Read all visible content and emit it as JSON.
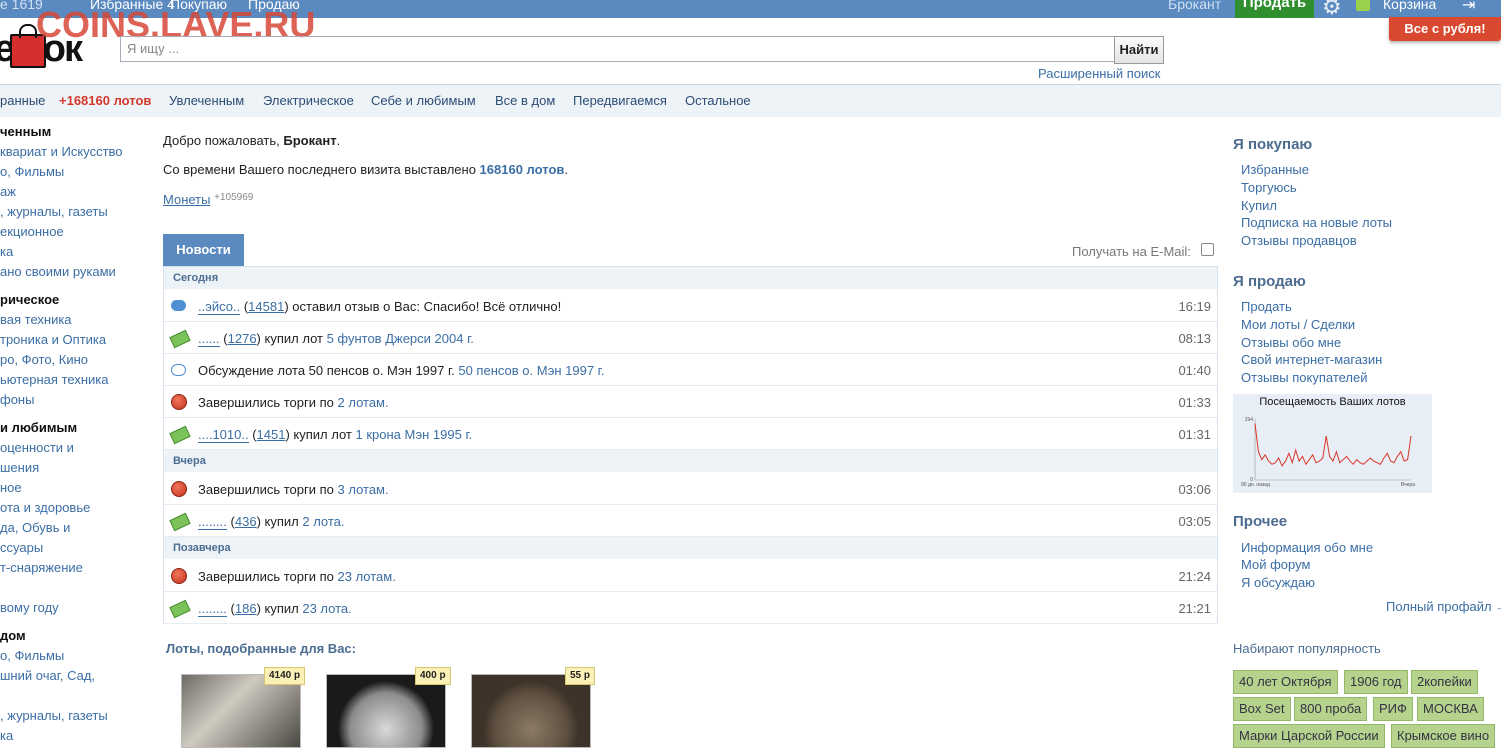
{
  "watermark": "COINS.LAVE.RU",
  "topbar": {
    "item1": "е 1619",
    "favorites": "Избранные 4",
    "buying": "Покупаю",
    "selling": "Продаю",
    "username": "Брокант",
    "sell_button": "Продать",
    "cart": "Корзина"
  },
  "logo": {
    "text": "ешок"
  },
  "search": {
    "placeholder": "Я ищу ...",
    "button": "Найти",
    "advanced": "Расширенный поиск"
  },
  "promo": "Все с рубля!",
  "nav": [
    "ранные",
    "+168160 лотов",
    "Увлеченным",
    "Электрическое",
    "Себе и любимым",
    "Все в дом",
    "Передвигаемся",
    "Остальное"
  ],
  "sidebar": [
    {
      "t": "ченным",
      "h": true
    },
    {
      "t": "квариат и Искусство"
    },
    {
      "t": "о, Фильмы"
    },
    {
      "t": "аж"
    },
    {
      "t": ", журналы, газеты"
    },
    {
      "t": "екционное"
    },
    {
      "t": "ка"
    },
    {
      "t": "ано своими руками"
    },
    {
      "t": "рическое",
      "h": true
    },
    {
      "t": "вая техника"
    },
    {
      "t": "троника и Оптика"
    },
    {
      "t": "ро, Фото, Кино"
    },
    {
      "t": "ьютерная техника"
    },
    {
      "t": "фоны"
    },
    {
      "t": "и любимым",
      "h": true
    },
    {
      "t": "оценности и"
    },
    {
      "t": "шения"
    },
    {
      "t": "ное"
    },
    {
      "t": "ота и здоровье"
    },
    {
      "t": "да, Обувь и"
    },
    {
      "t": "ссуары"
    },
    {
      "t": "т-снаряжение"
    },
    {
      "t": "вому году"
    },
    {
      "t": "дом",
      "h": true
    },
    {
      "t": "о, Фильмы"
    },
    {
      "t": "шний очаг, Сад,"
    },
    {
      "t": ", журналы, газеты"
    },
    {
      "t": "ка"
    }
  ],
  "welcome": {
    "prefix": "Добро пожаловать, ",
    "name": "Брокант",
    "suffix": "."
  },
  "since": {
    "prefix": "Со времени Вашего последнего визита выставлено ",
    "count": "168160 лотов",
    "suffix": "."
  },
  "coins": {
    "label": "Монеты",
    "count": "+105969"
  },
  "news": {
    "tab": "Новости",
    "email_label": "Получать на E-Mail:"
  },
  "feed": {
    "days": [
      "Сегодня",
      "Вчера",
      "Позавчера"
    ],
    "rows": [
      {
        "user": "..эйсо..",
        "num": "14581",
        "text": " оставил отзыв о Вас: Спасибо! Всё отлично!",
        "link": "",
        "time": "16:19"
      },
      {
        "user": "......",
        "num": "1276",
        "text": " купил лот ",
        "link": "5 фунтов Джерси 2004 г.",
        "time": "08:13"
      },
      {
        "user": "",
        "num": "",
        "text": "Обсуждение лота 50 пенсов о. Мэн 1997 г. ",
        "link": "50 пенсов о. Мэн 1997 г.",
        "time": "01:40"
      },
      {
        "user": "",
        "num": "",
        "text": "Завершились торги по ",
        "link": "2 лотам.",
        "time": "01:33"
      },
      {
        "user": "....1010..",
        "num": "1451",
        "text": " купил лот ",
        "link": "1 крона Мэн 1995 г.",
        "time": "01:31"
      },
      {
        "user": "",
        "num": "",
        "text": "Завершились торги по ",
        "link": "3 лотам.",
        "time": "03:06"
      },
      {
        "user": "........",
        "num": "436",
        "text": " купил ",
        "link": "2 лота.",
        "time": "03:05"
      },
      {
        "user": "",
        "num": "",
        "text": "Завершились торги по ",
        "link": "23 лотам.",
        "time": "21:24"
      },
      {
        "user": "........",
        "num": "186",
        "text": " купил ",
        "link": "23 лота.",
        "time": "21:21"
      }
    ]
  },
  "picked_title": "Лоты, подобранные для Вас:",
  "lots": [
    {
      "price": "4140 р"
    },
    {
      "price": "400 р"
    },
    {
      "price": "55 р"
    }
  ],
  "right": {
    "buy_h": "Я покупаю",
    "buy": [
      "Избранные",
      "Торгуюсь",
      "Купил",
      "Подписка на новые лоты",
      "Отзывы продавцов"
    ],
    "sell_h": "Я продаю",
    "sell": [
      "Продать",
      "Мои лоты / Сделки",
      "Отзывы обо мне",
      "Свой интернет-магазин",
      "Отзывы покупателей"
    ],
    "other_h": "Прочее",
    "other": [
      "Информация обо мне",
      "Мой форум",
      "Я обсуждаю"
    ],
    "full_profile": "Полный профайл →",
    "popular_h": "Набирают популярность",
    "tags": [
      "40 лет Октября",
      "1906 год",
      "2копейки",
      "Box Set",
      "800 проба",
      "РИФ",
      "МОСКВА",
      "Марки Царской России",
      "Крымское вино"
    ]
  },
  "chart_data": {
    "type": "line",
    "title": "Посещаемость Ваших лотов",
    "xlabel": "",
    "ylabel": "",
    "x_tick_labels": [
      "90 дн. назад",
      "Вчера"
    ],
    "y_tick_labels": [
      "0",
      "194"
    ],
    "ylim": [
      0,
      194
    ],
    "values": [
      180,
      90,
      65,
      80,
      60,
      50,
      55,
      70,
      45,
      60,
      85,
      55,
      95,
      60,
      75,
      50,
      65,
      80,
      55,
      60,
      70,
      140,
      75,
      60,
      90,
      55,
      65,
      75,
      60,
      50,
      65,
      55,
      50,
      60,
      70,
      60,
      55,
      50,
      70,
      85,
      60,
      55,
      75,
      90,
      60,
      65,
      140
    ]
  }
}
